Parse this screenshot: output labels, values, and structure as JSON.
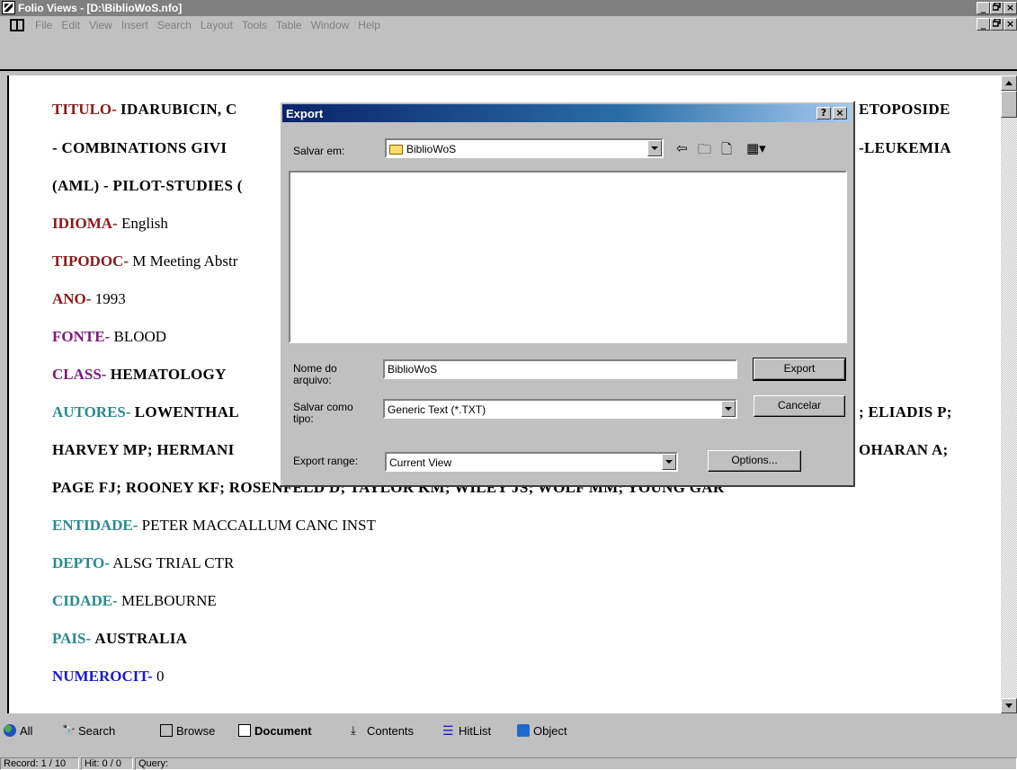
{
  "window": {
    "title": "Folio Views - [D:\\BiblioWoS.nfo]",
    "btn_min": "_",
    "btn_restore": "🗗",
    "btn_close": "×"
  },
  "menu": [
    "File",
    "Edit",
    "View",
    "Insert",
    "Search",
    "Layout",
    "Tools",
    "Table",
    "Window",
    "Help"
  ],
  "document": {
    "titulo_label": "TITULO-",
    "titulo_l1_left": "IDARUBICIN, C",
    "titulo_l1_right": "ETOPOSIDE",
    "titulo_l2_left": "- COMBINATIONS GIVI",
    "titulo_l2_right": "-LEUKEMIA",
    "titulo_l3_left": "(AML) - PILOT-STUDIES (",
    "idioma_label": "IDIOMA-",
    "idioma_value": "English",
    "tipodoc_label": "TIPODOC-",
    "tipodoc_value": "M Meeting Abstr",
    "ano_label": "ANO-",
    "ano_value": "1993",
    "fonte_label": "FONTE-",
    "fonte_value": "BLOOD",
    "class_label": "CLASS-",
    "class_value": "HEMATOLOGY",
    "autores_label": "AUTORES-",
    "autores_l1_left": "LOWENTHAL",
    "autores_l1_right": "; ELIADIS P;",
    "autores_l2_left": "HARVEY MP; HERMANI",
    "autores_l2_right": "OHARAN A;",
    "autores_l3": "PAGE FJ; ROONEY KF; ROSENFELD D; TAYLOR KM; WILEY JS; WOLF MM; YOUNG GAR",
    "entidade_label": "ENTIDADE-",
    "entidade_value": "PETER MACCALLUM CANC INST",
    "depto_label": "DEPTO-",
    "depto_value": "ALSG TRIAL CTR",
    "cidade_label": "CIDADE-",
    "cidade_value": "MELBOURNE",
    "pais_label": "PAIS-",
    "pais_value": "AUSTRALIA",
    "numerocit_label": "NUMEROCIT-",
    "numerocit_value": "0"
  },
  "dialog": {
    "title": "Export",
    "help_btn": "?",
    "close_btn": "×",
    "salvar_em_label": "Salvar em:",
    "salvar_em_value": "BiblioWoS",
    "nome_label_1": "Nome do",
    "nome_label_2": "arquivo:",
    "nome_value": "BiblioWoS",
    "tipo_label_1": "Salvar como",
    "tipo_label_2": "tipo:",
    "tipo_value": "Generic Text (*.TXT)",
    "range_label": "Export range:",
    "range_value": "Current View",
    "export_btn": "Export",
    "cancel_btn": "Cancelar",
    "options_btn": "Options..."
  },
  "tabs": {
    "all": "All",
    "search": "Search",
    "browse": "Browse",
    "document": "Document",
    "contents": "Contents",
    "hitlist": "HitList",
    "object": "Object"
  },
  "status": {
    "record": "Record: 1 / 10",
    "hit": "Hit: 0 / 0",
    "query": "Query:"
  },
  "colors": {
    "field_red": "#8b1a1a",
    "field_purple": "#7b1a7b",
    "field_teal": "#2a8a8a",
    "field_blue": "#1a1acc",
    "dialog_title_start": "#0a246a"
  }
}
